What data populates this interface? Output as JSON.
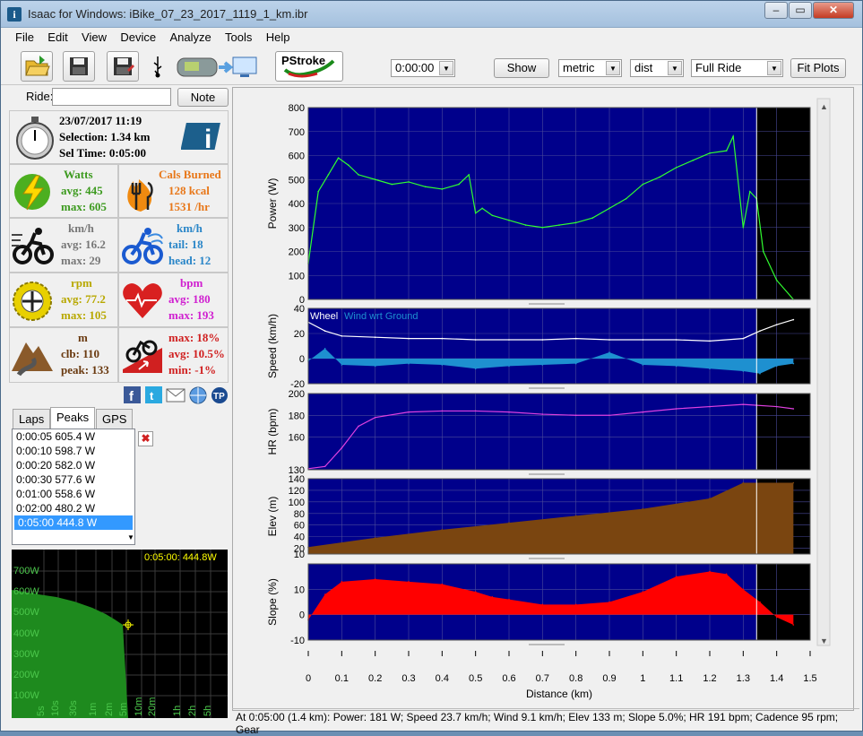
{
  "window": {
    "title": "Isaac for Windows:  iBike_07_23_2017_1119_1_km.ibr",
    "app_icon": "i"
  },
  "menu": [
    "File",
    "Edit",
    "View",
    "Device",
    "Analyze",
    "Tools",
    "Help"
  ],
  "toolbar": {
    "pstroke_label": "PStroke",
    "time_value": "0:00:00",
    "show_label": "Show",
    "units_value": "metric",
    "axis_value": "dist",
    "range_value": "Full Ride",
    "fit_label": "Fit Plots"
  },
  "ride": {
    "label": "Ride:",
    "value": "",
    "note_label": "Note"
  },
  "summary": {
    "datetime": "23/07/2017 11:19",
    "selection": "Selection: 1.34 km",
    "sel_time": "Sel Time: 0:05:00"
  },
  "stats": {
    "watts": {
      "title": "Watts",
      "avg": "avg: 445",
      "max": "max: 605"
    },
    "cals": {
      "title": "Cals Burned",
      "kcal": "128 kcal",
      "rate": "1531 /hr"
    },
    "speed": {
      "title": "km/h",
      "avg": "avg: 16.2",
      "max": "max: 29"
    },
    "wind": {
      "title": "km/h",
      "tail": "tail: 18",
      "head": "head: 12"
    },
    "cadence": {
      "title": "rpm",
      "avg": "avg: 77.2",
      "max": "max: 105"
    },
    "hr": {
      "title": "bpm",
      "avg": "avg: 180",
      "max": "max: 193"
    },
    "elev": {
      "title": "m",
      "clb": "clb: 110",
      "peak": "peak: 133"
    },
    "slope": {
      "max": "max: 18%",
      "avg": "avg: 10.5%",
      "min": "min: -1%"
    }
  },
  "tabs": [
    "Laps",
    "Peaks",
    "GPS"
  ],
  "peaks": [
    "0:00:05 605.4 W",
    "0:00:10 598.7 W",
    "0:00:20 582.0 W",
    "0:00:30 577.6 W",
    "0:01:00 558.6 W",
    "0:02:00 480.2 W",
    "0:05:00 444.8 W"
  ],
  "peak_chart": {
    "header": "0:05:00:  444.8W",
    "y_labels": [
      "700W",
      "600W",
      "500W",
      "400W",
      "300W",
      "200W",
      "100W"
    ],
    "x_labels": [
      "5s",
      "10s",
      "30s",
      "1m",
      "2m",
      "5m",
      "10m",
      "20m",
      "1h",
      "2h",
      "5h"
    ]
  },
  "chart_data": [
    {
      "type": "line",
      "ylabel": "Power (W)",
      "ylim": [
        0,
        800
      ],
      "yticks": [
        "0",
        "100",
        "200",
        "300",
        "400",
        "500",
        "600",
        "700",
        "800"
      ],
      "x": [
        0,
        0.03,
        0.06,
        0.09,
        0.12,
        0.15,
        0.2,
        0.25,
        0.3,
        0.35,
        0.4,
        0.45,
        0.48,
        0.5,
        0.52,
        0.55,
        0.6,
        0.65,
        0.7,
        0.75,
        0.8,
        0.85,
        0.9,
        0.95,
        1.0,
        1.05,
        1.1,
        1.15,
        1.2,
        1.25,
        1.27,
        1.3,
        1.32,
        1.34,
        1.36,
        1.4,
        1.45
      ],
      "series": [
        {
          "values": [
            150,
            450,
            520,
            590,
            560,
            520,
            500,
            480,
            490,
            470,
            460,
            480,
            520,
            360,
            380,
            350,
            330,
            310,
            300,
            310,
            320,
            340,
            380,
            420,
            480,
            510,
            550,
            580,
            610,
            620,
            680,
            300,
            450,
            420,
            200,
            80,
            0
          ]
        }
      ]
    },
    {
      "type": "line",
      "ylabel": "Speed (km/h)",
      "ylim": [
        -20,
        40
      ],
      "yticks": [
        "-20",
        "0",
        "20",
        "40"
      ],
      "x": [
        0,
        0.05,
        0.1,
        0.2,
        0.3,
        0.4,
        0.5,
        0.6,
        0.7,
        0.8,
        0.9,
        1.0,
        1.1,
        1.2,
        1.3,
        1.35,
        1.4,
        1.45
      ],
      "series": [
        {
          "name": "Wheel",
          "values": [
            29,
            22,
            18,
            17,
            16,
            16,
            15,
            15,
            15,
            16,
            15,
            15,
            15,
            14,
            16,
            22,
            27,
            31
          ]
        },
        {
          "name": "Wind wrt Ground",
          "values": [
            -2,
            8,
            -5,
            -6,
            -4,
            -5,
            -8,
            -6,
            -5,
            -4,
            5,
            -5,
            -6,
            -8,
            -10,
            -12,
            -6,
            -4
          ]
        }
      ]
    },
    {
      "type": "line",
      "ylabel": "HR (bpm)",
      "ylim": [
        130,
        200
      ],
      "yticks": [
        "130",
        "160",
        "180",
        "200"
      ],
      "x": [
        0,
        0.05,
        0.1,
        0.15,
        0.2,
        0.3,
        0.4,
        0.5,
        0.6,
        0.7,
        0.8,
        0.9,
        1.0,
        1.1,
        1.2,
        1.3,
        1.4,
        1.45
      ],
      "series": [
        {
          "values": [
            131,
            133,
            150,
            170,
            178,
            183,
            184,
            184,
            183,
            181,
            180,
            180,
            183,
            186,
            188,
            190,
            188,
            186
          ]
        }
      ]
    },
    {
      "type": "area",
      "ylabel": "Elev (m)",
      "ylim": [
        10,
        140
      ],
      "yticks": [
        "10",
        "20",
        "40",
        "60",
        "80",
        "100",
        "120",
        "140"
      ],
      "x": [
        0,
        0.2,
        0.4,
        0.6,
        0.8,
        1.0,
        1.2,
        1.3,
        1.45
      ],
      "series": [
        {
          "values": [
            22,
            38,
            52,
            64,
            76,
            88,
            106,
            133,
            133
          ]
        }
      ]
    },
    {
      "type": "area",
      "ylabel": "Slope (%)",
      "ylim": [
        -10,
        20
      ],
      "yticks": [
        "-10",
        "0",
        "10"
      ],
      "x": [
        0,
        0.05,
        0.1,
        0.2,
        0.3,
        0.4,
        0.5,
        0.55,
        0.6,
        0.7,
        0.8,
        0.9,
        1.0,
        1.1,
        1.2,
        1.25,
        1.3,
        1.35,
        1.4,
        1.45
      ],
      "series": [
        {
          "values": [
            -2,
            8,
            13,
            14,
            13,
            12,
            9,
            7,
            6,
            4,
            4,
            5,
            9,
            15,
            17,
            16,
            10,
            5,
            -1,
            -4
          ]
        }
      ]
    },
    {
      "type": "axis",
      "xlabel": "Distance (km)",
      "xlim": [
        0,
        1.5
      ],
      "xticks": [
        "0",
        "0.1",
        "0.2",
        "0.3",
        "0.4",
        "0.5",
        "0.6",
        "0.7",
        "0.8",
        "0.9",
        "1",
        "1.1",
        "1.2",
        "1.3",
        "1.4",
        "1.5"
      ],
      "selection_end": 1.34
    }
  ],
  "status": "At 0:05:00 (1.4 km): Power: 181 W; Speed 23.7 km/h; Wind 9.1 km/h; Elev 133 m; Slope 5.0%; HR 191 bpm; Cadence 95 rpm; Gear"
}
